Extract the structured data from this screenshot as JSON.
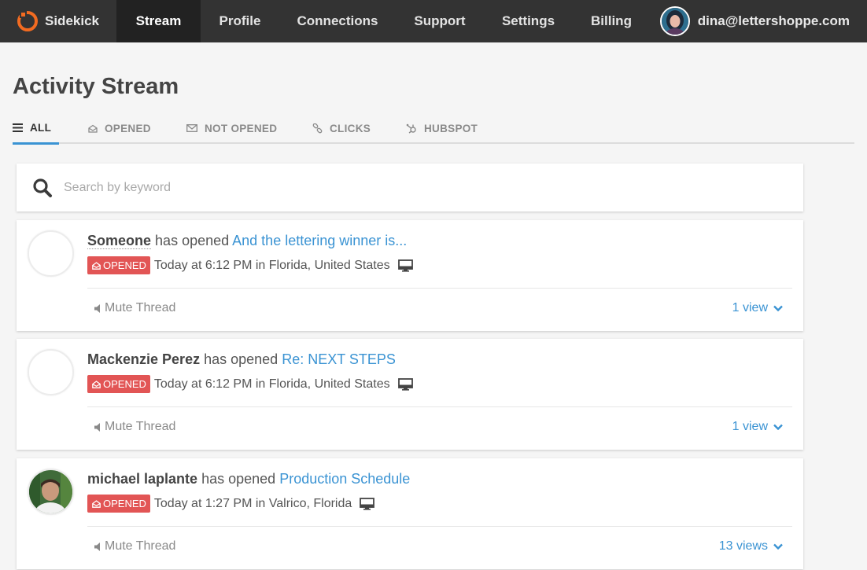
{
  "nav": {
    "brand": "Sidekick",
    "items": [
      {
        "label": "Stream",
        "active": true
      },
      {
        "label": "Profile",
        "active": false
      },
      {
        "label": "Connections",
        "active": false
      },
      {
        "label": "Support",
        "active": false
      },
      {
        "label": "Settings",
        "active": false
      },
      {
        "label": "Billing",
        "active": false
      }
    ],
    "user_email": "dina@lettershoppe.com"
  },
  "page": {
    "title": "Activity Stream",
    "tabs": [
      {
        "label": "ALL",
        "icon": "list-icon",
        "active": true
      },
      {
        "label": "OPENED",
        "icon": "opened-envelope-icon",
        "active": false
      },
      {
        "label": "NOT OPENED",
        "icon": "envelope-icon",
        "active": false
      },
      {
        "label": "CLICKS",
        "icon": "link-icon",
        "active": false
      },
      {
        "label": "HUBSPOT",
        "icon": "hubspot-icon",
        "active": false
      }
    ]
  },
  "search": {
    "placeholder": "Search by keyword",
    "value": ""
  },
  "activities": [
    {
      "sender": "Someone",
      "verb": "has opened",
      "subject": "And the lettering winner is...",
      "badge": "OPENED",
      "meta": "Today at 6:12 PM in Florida, United States",
      "mute_label": "Mute Thread",
      "views": "1 view",
      "avatar": "placeholder"
    },
    {
      "sender": "Mackenzie Perez",
      "verb": "has opened",
      "subject": "Re: NEXT STEPS",
      "badge": "OPENED",
      "meta": "Today at 6:12 PM in Florida, United States",
      "mute_label": "Mute Thread",
      "views": "1 view",
      "avatar": "placeholder"
    },
    {
      "sender": "michael laplante",
      "verb": "has opened",
      "subject": "Production Schedule",
      "badge": "OPENED",
      "meta": "Today at 1:27 PM in Valrico, Florida",
      "mute_label": "Mute Thread",
      "views": "13 views",
      "avatar": "photo"
    }
  ],
  "colors": {
    "nav_bg": "#333333",
    "nav_active_bg": "#222222",
    "accent": "#3a93d3",
    "badge": "#e25555",
    "brand_logo": "#f26b21"
  }
}
